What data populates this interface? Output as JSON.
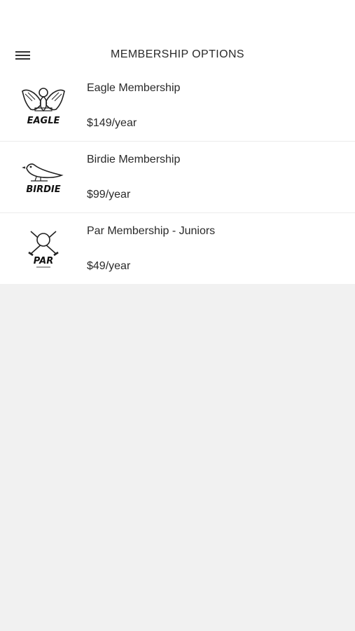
{
  "header": {
    "title": "MEMBERSHIP OPTIONS",
    "menu_icon": "hamburger-menu-icon"
  },
  "memberships": [
    {
      "name": "Eagle Membership",
      "price": "$149/year",
      "logo_text": "EAGLE",
      "logo_icon": "eagle-logo"
    },
    {
      "name": "Birdie Membership",
      "price": "$99/year",
      "logo_text": "BIRDIE",
      "logo_icon": "birdie-logo"
    },
    {
      "name": "Par Membership - Juniors",
      "price": "$49/year",
      "logo_text": "PAR",
      "logo_icon": "par-logo"
    }
  ],
  "colors": {
    "background": "#f1f1f1",
    "surface": "#ffffff",
    "text": "#2a2a2a",
    "divider": "#ececec"
  }
}
